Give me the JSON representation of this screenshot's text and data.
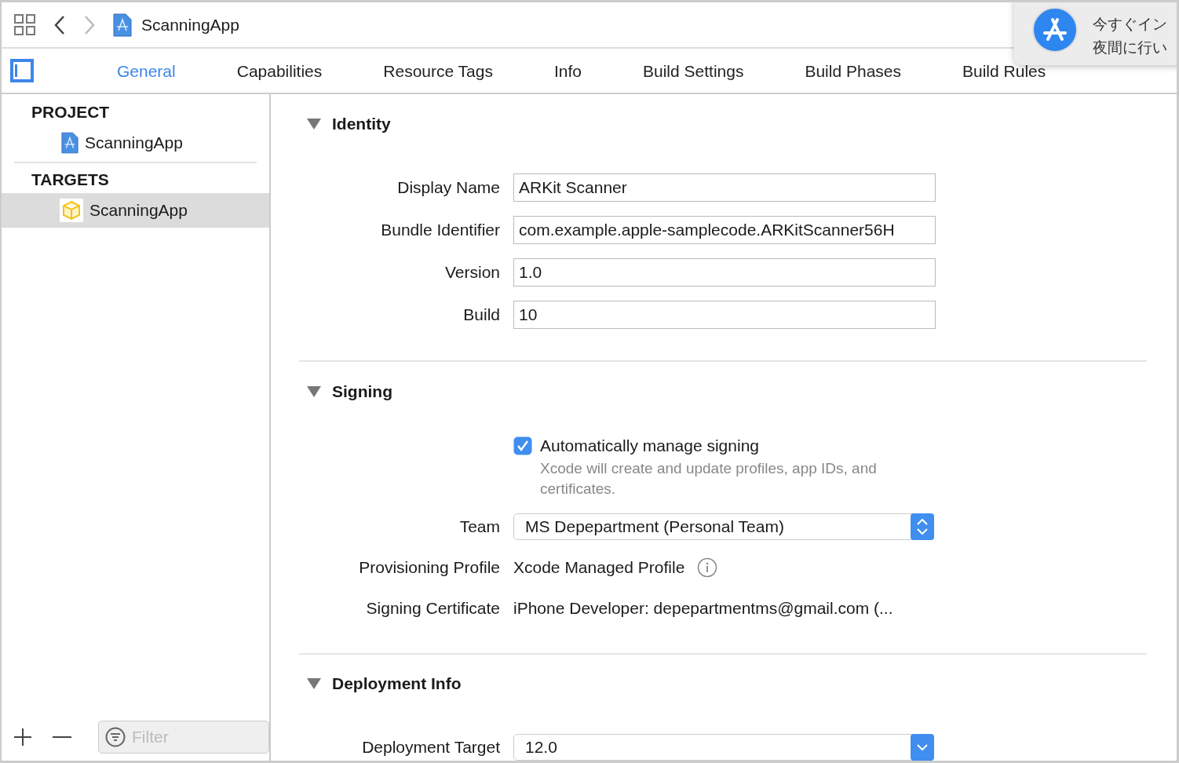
{
  "toolbar": {
    "title": "ScanningApp",
    "forward_disabled": true
  },
  "tabs": [
    {
      "label": "General",
      "selected": true
    },
    {
      "label": "Capabilities",
      "selected": false
    },
    {
      "label": "Resource Tags",
      "selected": false
    },
    {
      "label": "Info",
      "selected": false
    },
    {
      "label": "Build Settings",
      "selected": false
    },
    {
      "label": "Build Phases",
      "selected": false
    },
    {
      "label": "Build Rules",
      "selected": false
    }
  ],
  "notification": {
    "lines": [
      "今すぐイン",
      "夜間に行い"
    ]
  },
  "sidebar": {
    "sections": [
      {
        "heading": "PROJECT",
        "items": [
          {
            "label": "ScanningApp",
            "kind": "project",
            "selected": false
          }
        ]
      },
      {
        "heading": "TARGETS",
        "items": [
          {
            "label": "ScanningApp",
            "kind": "target",
            "selected": true
          }
        ]
      }
    ],
    "filter": {
      "placeholder": "Filter"
    }
  },
  "sections": [
    {
      "title": "Identity",
      "expanded": true,
      "rows": [
        {
          "kind": "field",
          "label": "Display Name",
          "value": "ARKit Scanner"
        },
        {
          "kind": "field",
          "label": "Bundle Identifier",
          "value": "com.example.apple-samplecode.ARKitScanner56H"
        },
        {
          "kind": "field",
          "label": "Version",
          "value": "1.0"
        },
        {
          "kind": "field",
          "label": "Build",
          "value": "10"
        }
      ]
    },
    {
      "title": "Signing",
      "expanded": true,
      "rows": [
        {
          "kind": "checkbox",
          "label": "Automatically manage signing",
          "checked": true,
          "note": "Xcode will create and update profiles, app IDs, and certificates."
        },
        {
          "kind": "popup",
          "label": "Team",
          "value": "MS Depepartment (Personal Team)"
        },
        {
          "kind": "text",
          "label": "Provisioning Profile",
          "value": "Xcode Managed Profile",
          "info": true
        },
        {
          "kind": "text",
          "label": "Signing Certificate",
          "value": "iPhone Developer: depepartmentms@gmail.com (..."
        }
      ]
    },
    {
      "title": "Deployment Info",
      "expanded": true,
      "rows": [
        {
          "kind": "combo",
          "label": "Deployment Target",
          "value": "12.0"
        }
      ]
    }
  ]
}
